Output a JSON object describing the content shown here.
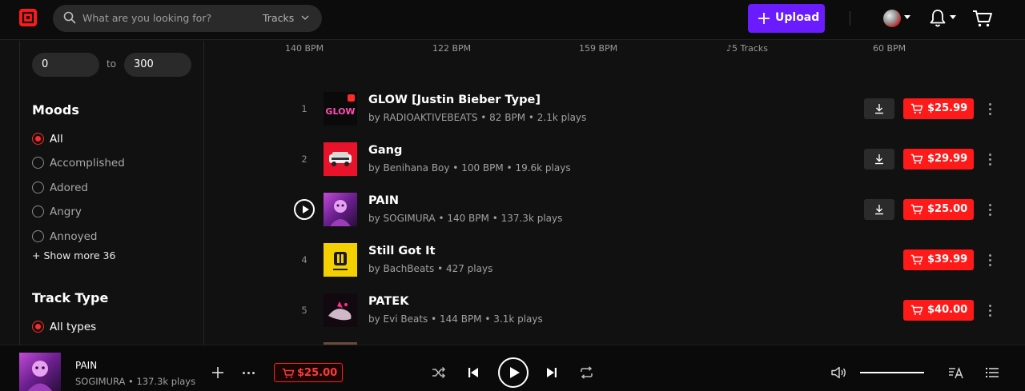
{
  "header": {
    "search_placeholder": "What are you looking for?",
    "search_scope": "Tracks",
    "upload_label": "Upload"
  },
  "filters": {
    "bpm_min": "0",
    "range_to": "to",
    "bpm_max": "300",
    "moods": {
      "title": "Moods",
      "options": [
        {
          "label": "All",
          "selected": true
        },
        {
          "label": "Accomplished",
          "selected": false
        },
        {
          "label": "Adored",
          "selected": false
        },
        {
          "label": "Angry",
          "selected": false
        },
        {
          "label": "Annoyed",
          "selected": false
        }
      ],
      "show_more": "+ Show more 36"
    },
    "track_type": {
      "title": "Track Type",
      "options": [
        {
          "label": "All types",
          "selected": true
        }
      ]
    }
  },
  "top_strip": [
    "140 BPM",
    "122 BPM",
    "159 BPM",
    "♪5 Tracks",
    "60 BPM"
  ],
  "tracks": [
    {
      "num": "1",
      "title": "GLOW [Justin Bieber Type]",
      "meta": "by RADIOAKTIVEBEATS • 82 BPM • 2.1k plays",
      "price": "$25.99",
      "download": true,
      "playing": false,
      "art": "glow"
    },
    {
      "num": "2",
      "title": "Gang",
      "meta": "by Benihana Boy • 100 BPM • 19.6k plays",
      "price": "$29.99",
      "download": true,
      "playing": false,
      "art": "gang"
    },
    {
      "num": "3",
      "title": "PAIN",
      "meta": "by SOGIMURA • 140 BPM • 137.3k plays",
      "price": "$25.00",
      "download": true,
      "playing": true,
      "art": "pain"
    },
    {
      "num": "4",
      "title": "Still Got It",
      "meta": "by BachBeats • 427 plays",
      "price": "$39.99",
      "download": false,
      "playing": false,
      "art": "bb"
    },
    {
      "num": "5",
      "title": "PATEK",
      "meta": "by Evi Beats • 144 BPM • 3.1k plays",
      "price": "$40.00",
      "download": false,
      "playing": false,
      "art": "patek"
    }
  ],
  "player": {
    "title": "PAIN",
    "meta": "SOGIMURA • 137.3k plays",
    "price": "$25.00",
    "volume": 1.0
  },
  "colors": {
    "accent_red": "#ff1a1a",
    "upload_purple": "#6a1bff",
    "background": "#111111"
  },
  "icons": [
    "logo-icon",
    "search-icon",
    "chevron-down-icon",
    "plus-icon",
    "avatar",
    "bell-icon",
    "cart-icon",
    "download-icon",
    "more-icon",
    "shuffle-icon",
    "previous-icon",
    "play-icon",
    "next-icon",
    "repeat-icon",
    "volume-icon",
    "lyrics-icon",
    "queue-icon"
  ]
}
